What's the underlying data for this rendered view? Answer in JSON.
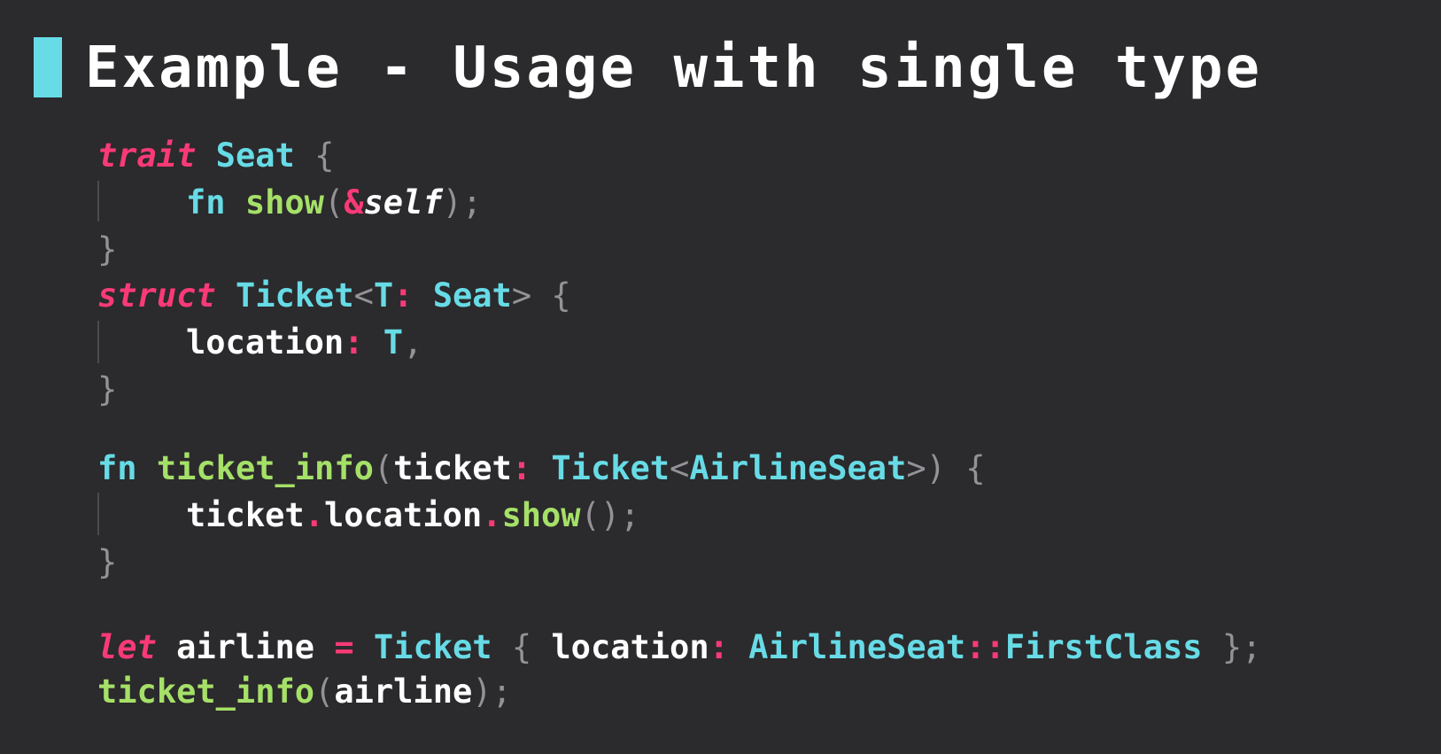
{
  "slide": {
    "title": "Example - Usage with single type"
  },
  "code": {
    "l1": {
      "kw": "trait",
      "name": "Seat",
      "brace": "{"
    },
    "l2": {
      "kw": "fn",
      "name": "show",
      "open": "(",
      "amp": "&",
      "self": "self",
      "close": ");"
    },
    "l3": {
      "brace": "}"
    },
    "l4": {
      "kw": "struct",
      "name": "Ticket",
      "lt": "<",
      "param": "T",
      "colon": ":",
      "bound": "Seat",
      "gt": ">",
      "brace": "{"
    },
    "l5": {
      "field": "location",
      "colon": ":",
      "type": "T",
      "comma": ","
    },
    "l6": {
      "brace": "}"
    },
    "l7": {
      "kw": "fn",
      "name": "ticket_info",
      "open": "(",
      "arg": "ticket",
      "colon": ":",
      "type": "Ticket",
      "lt": "<",
      "param": "AirlineSeat",
      "gt": ">",
      "close": ")",
      "brace": "{"
    },
    "l8": {
      "obj": "ticket",
      "dot1": ".",
      "field": "location",
      "dot2": ".",
      "method": "show",
      "call": "();"
    },
    "l9": {
      "brace": "}"
    },
    "l10": {
      "kw": "let",
      "var": "airline",
      "eq": "=",
      "type": "Ticket",
      "lbrace": "{",
      "field": "location",
      "colon": ":",
      "enum": "AirlineSeat",
      "path": "::",
      "variant": "FirstClass",
      "rbrace": "};"
    },
    "l11": {
      "name": "ticket_info",
      "open": "(",
      "arg": "airline",
      "close": ");"
    }
  }
}
